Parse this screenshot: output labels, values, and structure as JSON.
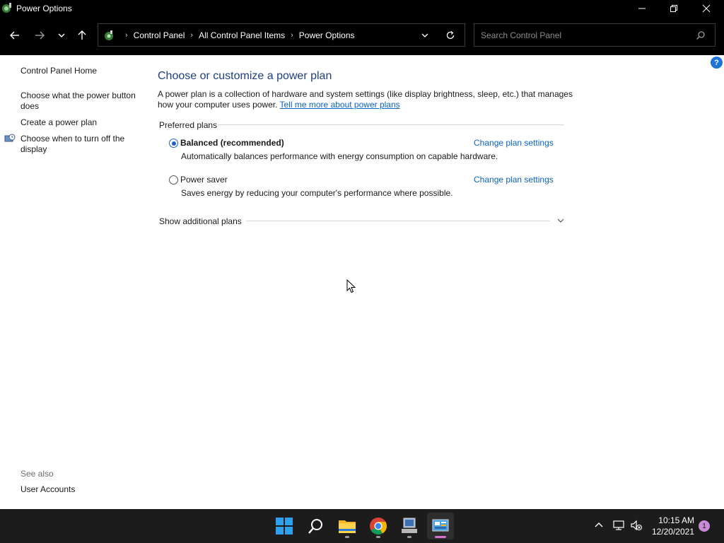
{
  "window": {
    "title": "Power Options",
    "app_icon": "power-options-icon",
    "controls": [
      "minimize-icon",
      "restore-icon",
      "close-icon"
    ]
  },
  "address_bar": {
    "location_icon": "control-panel-icon",
    "breadcrumbs": [
      "Control Panel",
      "All Control Panel Items",
      "Power Options"
    ],
    "search_placeholder": "Search Control Panel"
  },
  "sidebar": {
    "home": "Control Panel Home",
    "links": [
      "Choose what the power button does",
      "Create a power plan",
      "Choose when to turn off the display"
    ],
    "see_also_label": "See also",
    "see_also_links": [
      "User Accounts"
    ]
  },
  "main": {
    "title": "Choose or customize a power plan",
    "intro": "A power plan is a collection of hardware and system settings (like display brightness, sleep, etc.) that manages how your computer uses power.",
    "intro_link": "Tell me more about power plans",
    "preferred_label": "Preferred plans",
    "plans": [
      {
        "name": "Balanced (recommended)",
        "description": "Automatically balances performance with energy consumption on capable hardware.",
        "link": "Change plan settings",
        "selected": true
      },
      {
        "name": "Power saver",
        "description": "Saves energy by reducing your computer's performance where possible.",
        "link": "Change plan settings",
        "selected": false
      }
    ],
    "show_more_label": "Show additional plans",
    "help_label": "?"
  },
  "taskbar": {
    "apps": [
      "start-icon",
      "search-icon",
      "file-explorer-icon",
      "chrome-icon",
      "remote-desktop-icon",
      "control-panel-icon"
    ],
    "active_app": "control-panel-icon",
    "time": "10:15 AM",
    "date": "12/20/2021",
    "notification_count": "1"
  },
  "colors": {
    "accent": "#1e62c8",
    "title_blue": "#1e3f83",
    "link_blue": "#0b63c4",
    "chrome_bg": "#000000",
    "taskbar_bg": "#1c1c1c"
  }
}
